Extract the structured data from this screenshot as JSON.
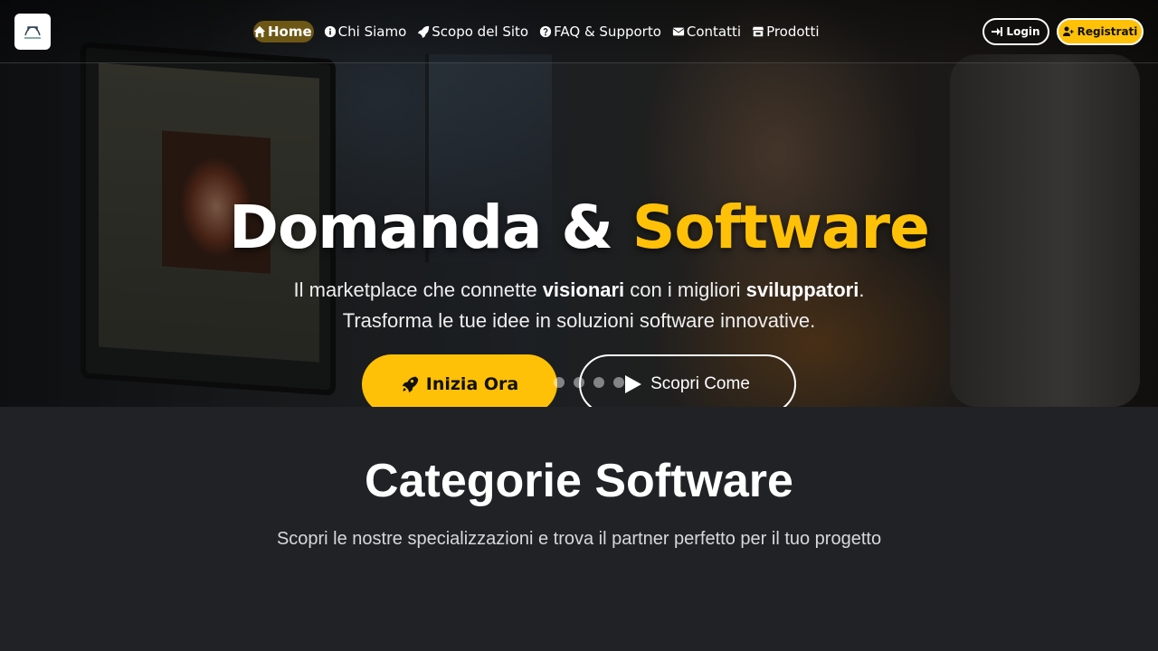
{
  "header": {
    "logo_icon": "handshake-logo-icon",
    "nav": [
      {
        "label": "Home",
        "icon": "home-icon",
        "active": true
      },
      {
        "label": "Chi Siamo",
        "icon": "info-icon"
      },
      {
        "label": "Scopo del Sito",
        "icon": "rocket-icon"
      },
      {
        "label": "FAQ & Supporto",
        "icon": "question-icon"
      },
      {
        "label": "Contatti",
        "icon": "envelope-icon"
      },
      {
        "label": "Prodotti",
        "icon": "store-icon"
      }
    ],
    "login_label": "Login",
    "register_label": "Registrati"
  },
  "hero": {
    "title_part1": "Domanda & ",
    "title_accent": "Software",
    "sub_line1_a": "Il marketplace che connette ",
    "sub_line1_b": "visionari",
    "sub_line1_c": " con i migliori ",
    "sub_line1_d": "sviluppatori",
    "sub_line1_e": ".",
    "sub_line2": "Trasforma le tue idee in soluzioni software innovative.",
    "cta_primary": "Inizia Ora",
    "cta_secondary": "Scopri Come",
    "carousel_slides": 5,
    "carousel_active": 1
  },
  "categories": {
    "title": "Categorie Software",
    "subtitle": "Scopri le nostre specializzazioni e trova il partner perfetto per il tuo progetto"
  },
  "colors": {
    "accent": "#ffc107",
    "background": "#202226"
  }
}
